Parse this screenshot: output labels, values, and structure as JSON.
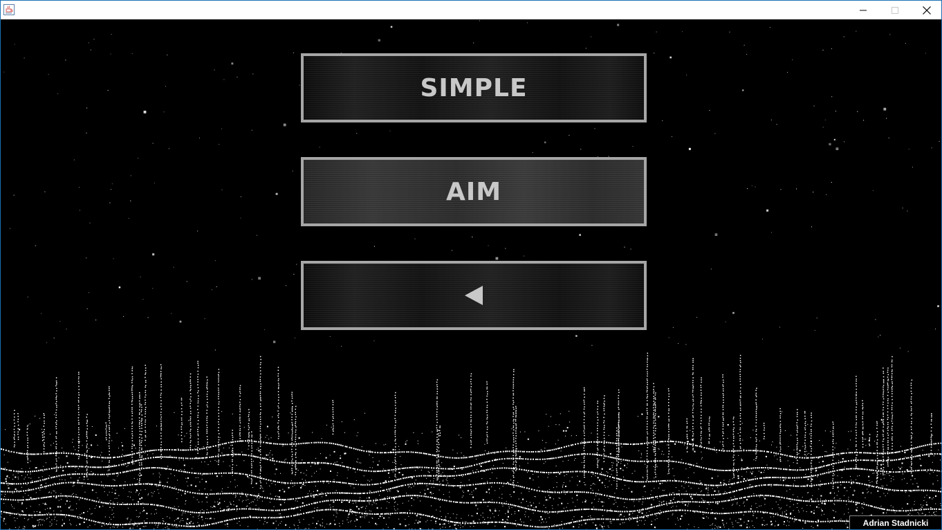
{
  "window": {
    "title": "",
    "app_icon": "java-coffee-icon",
    "controls": [
      "minimize-icon",
      "maximize-icon",
      "close-icon"
    ]
  },
  "menu": {
    "buttons": [
      {
        "id": "simple",
        "label": "SIMPLE",
        "state": "normal"
      },
      {
        "id": "aim",
        "label": "AIM",
        "state": "hover"
      },
      {
        "id": "back",
        "icon": "back-arrow-icon",
        "state": "normal"
      }
    ]
  },
  "credit": {
    "text": "Adrian Stadnicki"
  },
  "colors": {
    "button_border": "#a6a6a6",
    "button_text": "#c8c8c8",
    "background": "#000000",
    "particles": "#ffffff",
    "window_border": "#1a6fb5"
  }
}
